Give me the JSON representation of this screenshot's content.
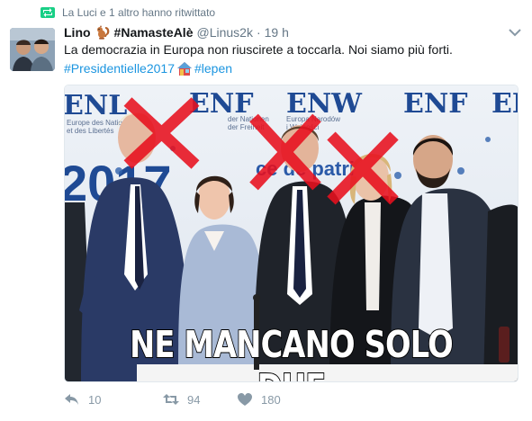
{
  "retweet_context": {
    "text": "La Luci e 1 altro hanno ritwittato",
    "icon": "retweet-icon",
    "color": "#19cf86"
  },
  "tweet": {
    "author_name": "Lino",
    "author_emoji": "squirrel-icon",
    "author_hashtag": "#NamasteAlè",
    "handle": "@Linus2k",
    "separator": "·",
    "time": "19 h",
    "text": "La democrazia in Europa non riuscirete a toccarla. Noi siamo più forti.",
    "hashtags": [
      "#Presidentielle2017",
      "#lepen"
    ],
    "hashtag_emoji": "house-icon"
  },
  "media": {
    "caption": "NE MANCANO SOLO DUE",
    "backdrop_logos": [
      "ENL",
      "ENF",
      "ENW",
      "ENF",
      "EN"
    ],
    "backdrop_text": [
      "der Nationen",
      "der Freiheit",
      "Europa Narodów",
      "i Wolności",
      "Europe des Nations",
      "et des Libertés",
      "2017",
      "ce de patri"
    ]
  },
  "actions": {
    "reply": {
      "icon": "reply-icon",
      "count": "10"
    },
    "retweet": {
      "icon": "retweet-icon",
      "count": "94"
    },
    "like": {
      "icon": "heart-icon",
      "count": "180"
    }
  },
  "colors": {
    "link": "#1b95e0",
    "meta": "#657786",
    "action": "#8899a6",
    "retweet_green": "#19cf86",
    "cross_red": "#e8101e"
  }
}
